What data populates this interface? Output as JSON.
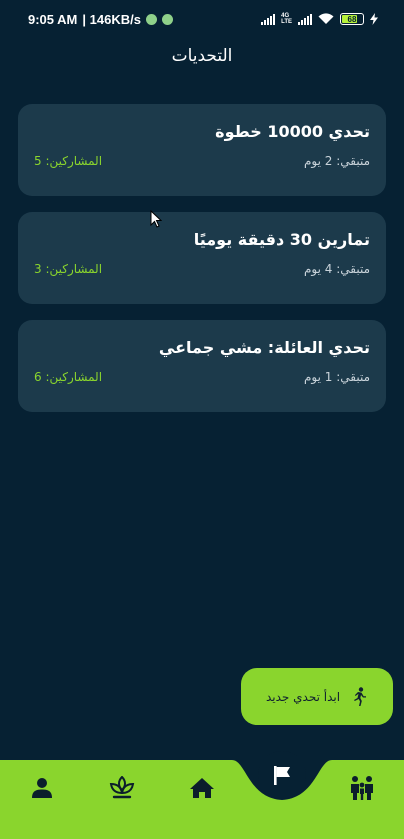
{
  "status": {
    "time": "9:05 AM",
    "speed": "| 146KB/s",
    "network_top": "4G",
    "network_bottom": "LTE",
    "battery": "68"
  },
  "header": {
    "title": "التحديات"
  },
  "challenges": [
    {
      "title": "تحدي 10000 خطوة",
      "remaining": "متبقي: 2 يوم",
      "participants": "المشاركين: 5"
    },
    {
      "title": "تمارين 30 دقيقة يوميًا",
      "remaining": "متبقي: 4 يوم",
      "participants": "المشاركين: 3"
    },
    {
      "title": "تحدي العائلة: مشي جماعي",
      "remaining": "متبقي: 1 يوم",
      "participants": "المشاركين: 6"
    }
  ],
  "fab": {
    "label": "ابدأ تحدي جديد",
    "icon": "running-person-icon"
  },
  "nav": {
    "items": [
      "profile-icon",
      "plant-icon",
      "home-icon",
      "flag-icon",
      "family-icon"
    ],
    "active": "flag-icon"
  },
  "colors": {
    "background": "#062133",
    "card": "#1c3a4b",
    "accent": "#8ad52d"
  }
}
